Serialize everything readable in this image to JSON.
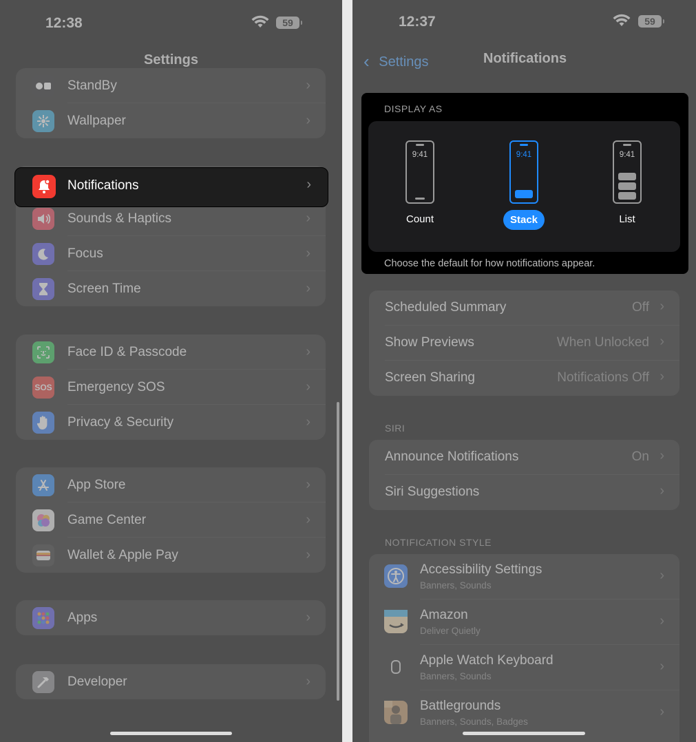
{
  "left": {
    "status": {
      "time": "12:38",
      "battery": "59"
    },
    "nav_title": "Settings",
    "groups": [
      {
        "top": "group1",
        "items": [
          {
            "label": "StandBy",
            "icon": "standby-icon",
            "color": "#2c2c2e"
          },
          {
            "label": "Wallpaper",
            "icon": "wallpaper-icon",
            "color": "#35aadc"
          }
        ]
      },
      {
        "items": [
          {
            "label": "Notifications",
            "icon": "bell-icon",
            "color": "#f23a30"
          },
          {
            "label": "Sounds & Haptics",
            "icon": "speaker-icon",
            "color": "#ee4459"
          },
          {
            "label": "Focus",
            "icon": "moon-icon",
            "color": "#5e5ce6"
          },
          {
            "label": "Screen Time",
            "icon": "hourglass-icon",
            "color": "#5e5ce6"
          }
        ]
      },
      {
        "items": [
          {
            "label": "Face ID & Passcode",
            "icon": "faceid-icon",
            "color": "#34c759"
          },
          {
            "label": "Emergency SOS",
            "icon": "sos-icon",
            "color": "#e5413a"
          },
          {
            "label": "Privacy & Security",
            "icon": "hand-icon",
            "color": "#3a82f7"
          }
        ]
      },
      {
        "items": [
          {
            "label": "App Store",
            "icon": "appstore-icon",
            "color": "#2f8df6"
          },
          {
            "label": "Game Center",
            "icon": "gamecenter-icon",
            "color": "#e8e8e8"
          },
          {
            "label": "Wallet & Apple Pay",
            "icon": "wallet-icon",
            "color": "#3a3a3a"
          }
        ]
      },
      {
        "items": [
          {
            "label": "Apps",
            "icon": "apps-icon",
            "color": "#5e5ce6"
          }
        ]
      },
      {
        "items": [
          {
            "label": "Developer",
            "icon": "hammer-icon",
            "color": "#8e8e93"
          }
        ]
      }
    ]
  },
  "right": {
    "status": {
      "time": "12:37",
      "battery": "59"
    },
    "back_label": "Settings",
    "nav_title": "Notifications",
    "display_as": {
      "header": "DISPLAY AS",
      "options": [
        {
          "label": "Count",
          "time": "9:41"
        },
        {
          "label": "Stack",
          "time": "9:41",
          "selected": true
        },
        {
          "label": "List",
          "time": "9:41"
        }
      ],
      "footer": "Choose the default for how notifications appear."
    },
    "general": [
      {
        "label": "Scheduled Summary",
        "value": "Off"
      },
      {
        "label": "Show Previews",
        "value": "When Unlocked"
      },
      {
        "label": "Screen Sharing",
        "value": "Notifications Off"
      }
    ],
    "siri_header": "SIRI",
    "siri": [
      {
        "label": "Announce Notifications",
        "value": "On"
      },
      {
        "label": "Siri Suggestions",
        "value": ""
      }
    ],
    "style_header": "NOTIFICATION STYLE",
    "apps": [
      {
        "label": "Accessibility Settings",
        "sub": "Banners, Sounds",
        "icon": "accessibility-icon",
        "color": "#3a82f7"
      },
      {
        "label": "Amazon",
        "sub": "Deliver Quietly",
        "icon": "amazon-icon",
        "color": "#f2d9b0"
      },
      {
        "label": "Apple Watch Keyboard",
        "sub": "Banners, Sounds",
        "icon": "watch-keyboard-icon",
        "color": "#2b2b2b"
      },
      {
        "label": "Battlegrounds",
        "sub": "Banners, Sounds, Badges",
        "icon": "battlegrounds-icon",
        "color": "#c49a6c"
      }
    ]
  }
}
